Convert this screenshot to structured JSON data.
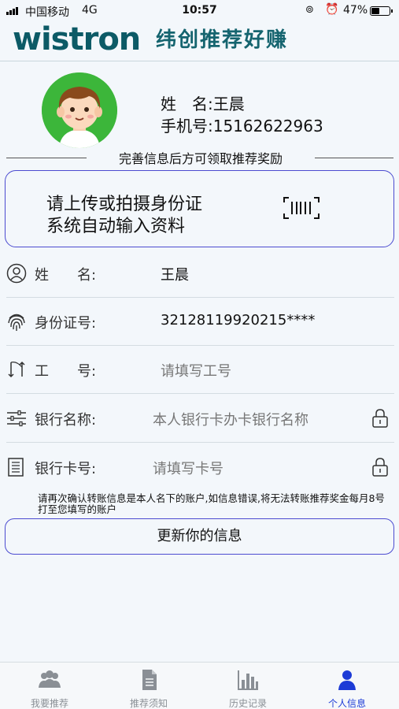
{
  "status_bar": {
    "carrier": "中国移动",
    "network": "4G",
    "time": "10:57",
    "battery": "47%",
    "battery_level": 0.47
  },
  "header": {
    "logo": "wistron",
    "slogan": "纬创推荐好赚"
  },
  "profile": {
    "name_line": "姓　名:王晨",
    "phone_line": "手机号:15162622963",
    "divider_text": "完善信息后方可领取推荐奖励"
  },
  "upload": {
    "line1": "请上传或拍摄身份证",
    "line2": "系统自动输入资料",
    "icon": "barcode-scan-icon"
  },
  "form": {
    "rows": [
      {
        "icon": "user-icon",
        "label": "姓　　名:",
        "value": "王晨",
        "placeholder": ""
      },
      {
        "icon": "fingerprint-icon",
        "label": "身份证号:",
        "value": "32128119920215****",
        "placeholder": ""
      },
      {
        "icon": "swap-icon",
        "label": "工　　号:",
        "value": "",
        "placeholder": "请填写工号"
      },
      {
        "icon": "sliders-icon",
        "label": "银行名称:",
        "value": "",
        "placeholder": "本人银行卡办卡银行名称"
      },
      {
        "icon": "document-icon",
        "label": "银行卡号:",
        "value": "",
        "placeholder": "请填写卡号"
      }
    ]
  },
  "notice": "请再次确认转账信息是本人名下的账户,如信息错误,将无法转账推荐奖金每月8号打至您填写的账户",
  "update_button": "更新你的信息",
  "tabs": [
    {
      "icon": "group-icon",
      "label": "我要推荐",
      "active": false
    },
    {
      "icon": "doc-icon",
      "label": "推荐须知",
      "active": false
    },
    {
      "icon": "bar-chart-icon",
      "label": "历史记录",
      "active": false
    },
    {
      "icon": "person-icon",
      "label": "个人信息",
      "active": true
    }
  ],
  "colors": {
    "brand": "#0c5a66",
    "accent": "#4b4bd0",
    "active_tab": "#1d3bd6"
  }
}
